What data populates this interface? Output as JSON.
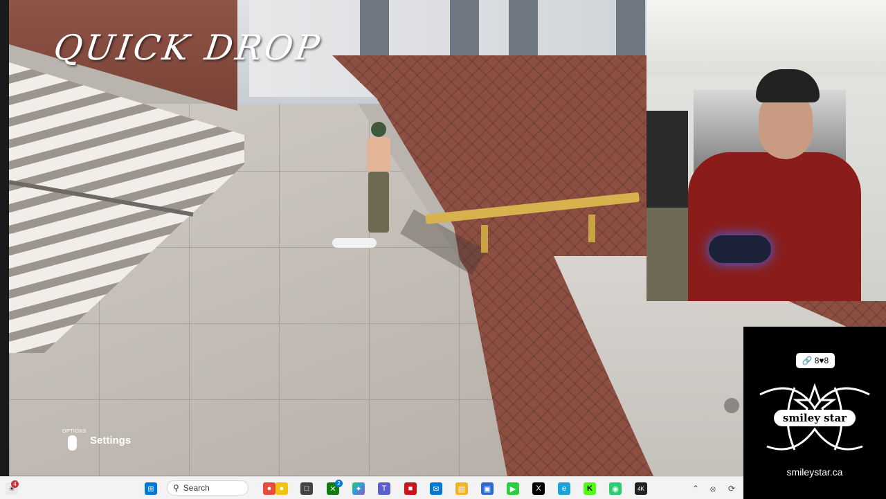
{
  "overlay": {
    "title": "QUICK DROP",
    "options_label": "OPTIONS",
    "settings_label": "Settings"
  },
  "logo_box": {
    "chip_text": "8♥8",
    "brand_text": "smiley star",
    "url": "smileystar.ca"
  },
  "taskbar": {
    "notification_count": "4",
    "search_placeholder": "Search",
    "xbox_badge": "2",
    "apps": [
      "start",
      "search",
      "fruit-widgets",
      "file-app",
      "xbox",
      "copilot",
      "teams",
      "app-red",
      "mail",
      "file-explorer",
      "store",
      "game-pass",
      "x",
      "edge",
      "kick",
      "discord",
      "4k-app"
    ],
    "colors": {
      "accent": "#0078d4",
      "kick": "#53fc18",
      "xbox": "#107c10",
      "red_app": "#c4161c"
    }
  }
}
